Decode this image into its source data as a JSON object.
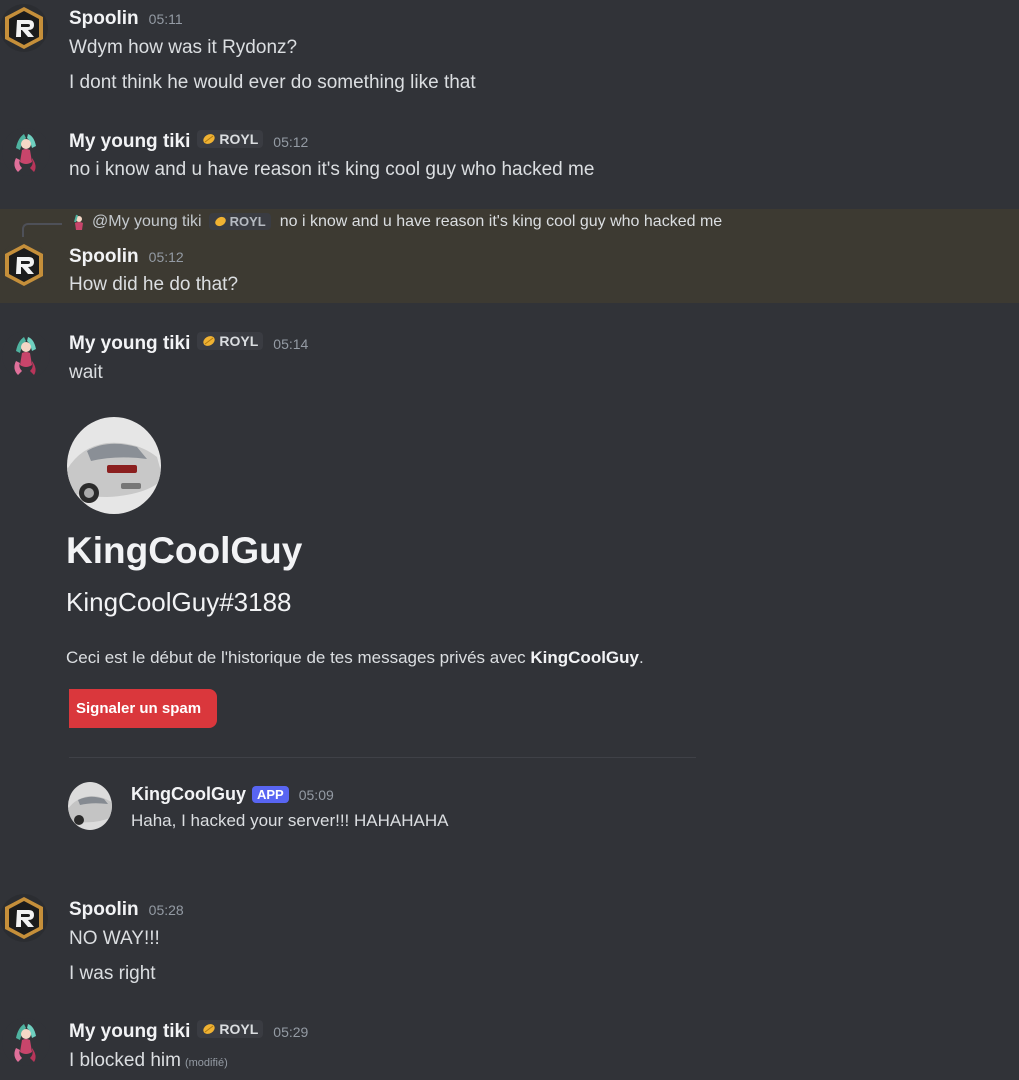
{
  "messages": {
    "m1": {
      "author": "Spoolin",
      "time": "05:11",
      "lines": [
        "Wdym how was it Rydonz?",
        "I dont think he would ever do something like that"
      ]
    },
    "m2": {
      "author": "My young tiki",
      "tag": "ROYL",
      "time": "05:12",
      "text": "no i know and u have reason it's king cool guy who hacked me"
    },
    "m3": {
      "reply": {
        "author": "@My young tiki",
        "tag": "ROYL",
        "text": "no i know and u have reason it's king cool guy who hacked me"
      },
      "author": "Spoolin",
      "time": "05:12",
      "text": "How did he do that?"
    },
    "m4": {
      "author": "My young tiki",
      "tag": "ROYL",
      "time": "05:14",
      "text": "wait"
    },
    "m5": {
      "author": "Spoolin",
      "time": "05:28",
      "lines": [
        "NO WAY!!!",
        "I was right"
      ]
    },
    "m6": {
      "author": "My young tiki",
      "tag": "ROYL",
      "time": "05:29",
      "text": "I blocked him",
      "edited": "(modifié)"
    }
  },
  "embed": {
    "name": "KingCoolGuy",
    "tag": "KingCoolGuy#3188",
    "desc_prefix": "Ceci est le début de l'historique de tes messages privés avec ",
    "desc_name": "KingCoolGuy",
    "desc_suffix": ".",
    "spam_button": "Signaler un spam",
    "dm": {
      "author": "KingCoolGuy",
      "badge": "APP",
      "time": "05:09",
      "text": "Haha, I hacked your server!!! HAHAHAHA"
    }
  },
  "colors": {
    "background": "#313338",
    "highlight": "#3d3a32",
    "danger": "#da373c",
    "app_badge": "#5865f2",
    "tag_icon": "#f0b232"
  },
  "icons": {
    "spoolin_avatar": "hexagon-r-logo",
    "tiki_avatar": "anime-character",
    "car_avatar": "silver-car",
    "tag_icon": "leaf-icon"
  }
}
